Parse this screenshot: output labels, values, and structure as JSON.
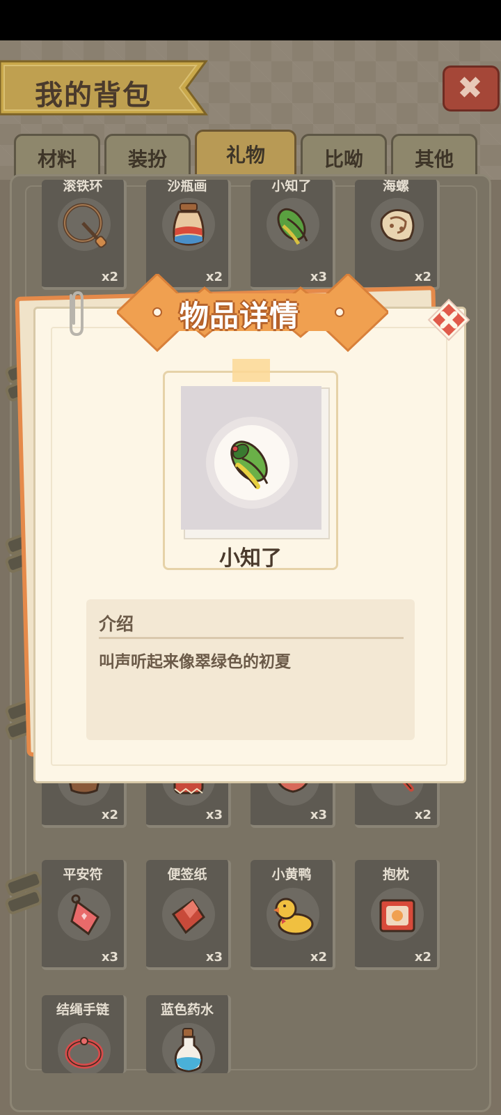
{
  "title": "我的背包",
  "tabs": [
    {
      "label": "材料"
    },
    {
      "label": "装扮"
    },
    {
      "label": "礼物"
    },
    {
      "label": "比呦"
    },
    {
      "label": "其他"
    }
  ],
  "active_tab": "礼物",
  "inventory": {
    "row1": [
      {
        "name": "滚铁环",
        "count": "x2",
        "icon": "iron-hoop-icon"
      },
      {
        "name": "沙瓶画",
        "count": "x2",
        "icon": "sand-bottle-icon"
      },
      {
        "name": "小知了",
        "count": "x3",
        "icon": "cicada-icon"
      },
      {
        "name": "海螺",
        "count": "x2",
        "icon": "conch-icon"
      }
    ],
    "row_hidden": [
      {
        "count": "x2",
        "icon": "lamp-icon"
      },
      {
        "count": "x3",
        "icon": "drum-icon"
      },
      {
        "count": "x3",
        "icon": "bowl-icon"
      },
      {
        "count": "x2",
        "icon": "rattle-icon"
      }
    ],
    "row3": [
      {
        "name": "平安符",
        "count": "x3",
        "icon": "amulet-icon"
      },
      {
        "name": "便签纸",
        "count": "x3",
        "icon": "sticky-note-icon"
      },
      {
        "name": "小黄鸭",
        "count": "x2",
        "icon": "rubber-duck-icon"
      },
      {
        "name": "抱枕",
        "count": "x2",
        "icon": "pillow-icon"
      }
    ],
    "row4": [
      {
        "name": "结绳手链",
        "icon": "bracelet-icon"
      },
      {
        "name": "蓝色药水",
        "icon": "blue-potion-icon"
      }
    ]
  },
  "detail": {
    "header": "物品详情",
    "item_name": "小知了",
    "intro_label": "介绍",
    "intro_text": "叫声听起来像翠绿色的初夏"
  },
  "colors": {
    "accent_orange": "#f0a050",
    "close_red": "#e05a4a",
    "text_brown": "#4a3a2c"
  }
}
